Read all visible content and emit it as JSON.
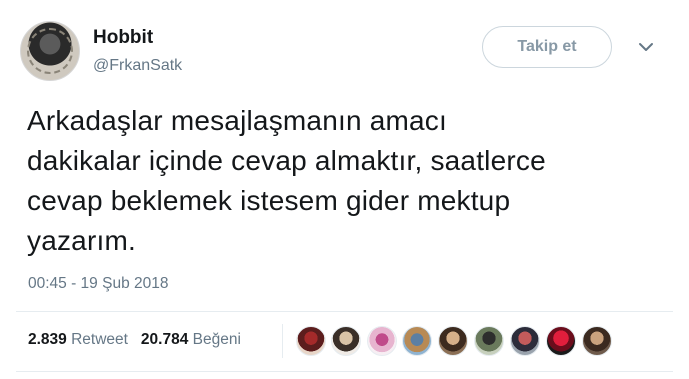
{
  "user": {
    "name": "Hobbit",
    "handle": "@FrkanSatk"
  },
  "follow_button": {
    "label": "Takip et"
  },
  "tweet": {
    "lines": [
      "Arkadaşlar mesajlaşmanın amacı",
      "dakikalar içinde cevap almaktır, saatlerce",
      "cevap beklemek istesem gider mektup",
      "yazarım."
    ],
    "timestamp": "00:45 - 19 Şub 2018"
  },
  "stats": {
    "retweet_count": "2.839",
    "retweet_label": "Retweet",
    "like_count": "20.784",
    "like_label": "Beğeni"
  },
  "colors": {
    "secondary_text": "#657786",
    "primary_text": "#14171a",
    "border": "#e6ecf0"
  },
  "icons": {
    "more": "chevron-down-icon"
  }
}
